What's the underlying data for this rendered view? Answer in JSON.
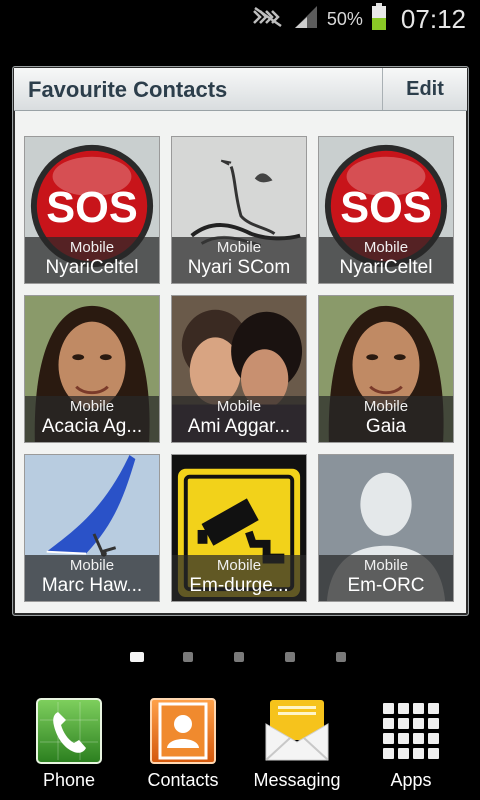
{
  "status_bar": {
    "battery_percent": "50%",
    "time": "07:12",
    "battery_level": 0.5,
    "icons": [
      "mute-icon",
      "signal-icon",
      "battery-icon"
    ]
  },
  "widget": {
    "title": "Favourite Contacts",
    "edit_label": "Edit"
  },
  "contacts": [
    {
      "type": "Mobile",
      "name": "NyariCeltel",
      "photo": "sos-icon"
    },
    {
      "type": "Mobile",
      "name": "Nyari SCom",
      "photo": "bird-sketch"
    },
    {
      "type": "Mobile",
      "name": "NyariCeltel",
      "photo": "sos-icon"
    },
    {
      "type": "Mobile",
      "name": "Acacia Ag...",
      "photo": "person-photo"
    },
    {
      "type": "Mobile",
      "name": "Ami Aggar...",
      "photo": "two-people-photo"
    },
    {
      "type": "Mobile",
      "name": "Gaia",
      "photo": "person-photo"
    },
    {
      "type": "Mobile",
      "name": "Marc Haw...",
      "photo": "hang-glider-photo"
    },
    {
      "type": "Mobile",
      "name": "Em-durge...",
      "photo": "cctv-sign-icon"
    },
    {
      "type": "Mobile",
      "name": "Em-ORC",
      "photo": "default-avatar-icon"
    }
  ],
  "page_indicator": {
    "pages": 5,
    "current": 1
  },
  "dock": [
    {
      "label": "Phone",
      "icon": "phone-icon",
      "color": "#3c9a2e"
    },
    {
      "label": "Contacts",
      "icon": "contacts-icon",
      "color": "#e8761c"
    },
    {
      "label": "Messaging",
      "icon": "envelope-icon",
      "color": "#f3c21a"
    },
    {
      "label": "Apps",
      "icon": "apps-grid-icon",
      "color": "#ffffff"
    }
  ]
}
